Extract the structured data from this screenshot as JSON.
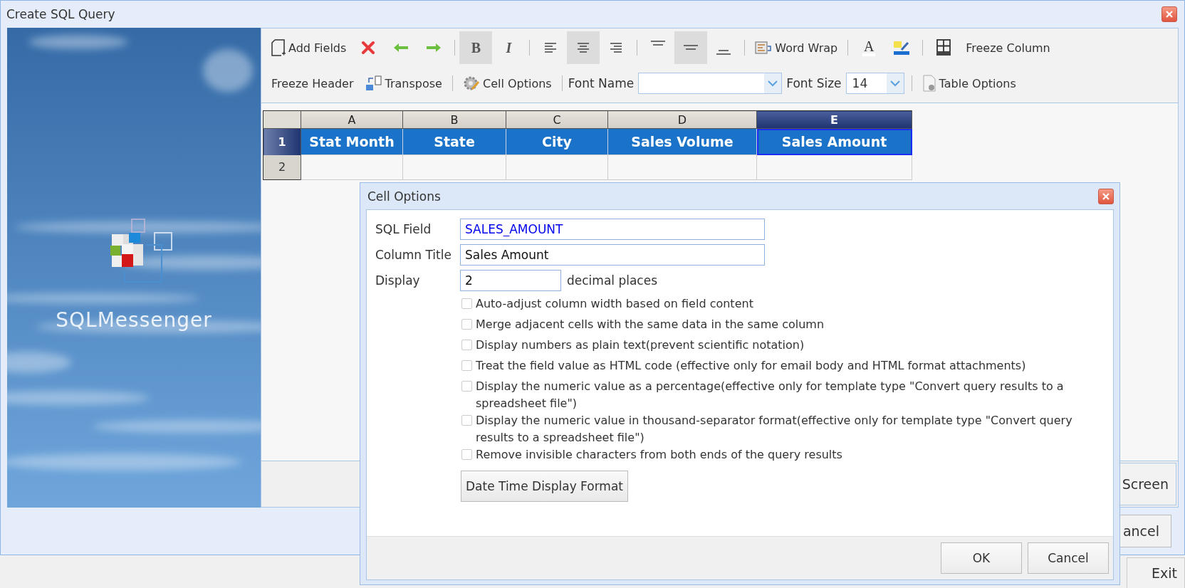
{
  "window": {
    "title": "Create SQL Query"
  },
  "brand": {
    "name": "SQLMessenger"
  },
  "toolbar": {
    "rows": [
      [
        {
          "kind": "add",
          "label": "Add Fields"
        },
        {
          "kind": "delete"
        },
        {
          "kind": "move-left"
        },
        {
          "kind": "move-right"
        },
        {
          "kind": "separator"
        },
        {
          "kind": "bold",
          "glyph": "B",
          "selected": true
        },
        {
          "kind": "italic",
          "glyph": "I",
          "selected": false
        },
        {
          "kind": "separator"
        },
        {
          "kind": "align-left",
          "selected": false
        },
        {
          "kind": "align-center",
          "selected": true
        },
        {
          "kind": "align-right",
          "selected": false
        },
        {
          "kind": "separator"
        },
        {
          "kind": "valign-top",
          "selected": false
        },
        {
          "kind": "valign-middle",
          "selected": true
        },
        {
          "kind": "valign-bottom",
          "selected": false
        },
        {
          "kind": "separator"
        },
        {
          "kind": "word-wrap",
          "label": "Word Wrap"
        },
        {
          "kind": "separator"
        },
        {
          "kind": "font-color",
          "glyph": "A"
        },
        {
          "kind": "highlight"
        },
        {
          "kind": "separator"
        },
        {
          "kind": "freeze-grid"
        },
        {
          "kind": "text",
          "label": "Freeze Column"
        }
      ],
      [
        {
          "kind": "text",
          "label": "Freeze Header"
        },
        {
          "kind": "transpose",
          "label": "Transpose"
        },
        {
          "kind": "separator"
        },
        {
          "kind": "cell-options",
          "label": "Cell Options"
        },
        {
          "kind": "separator"
        },
        {
          "kind": "field-label",
          "label": "Font Name"
        },
        {
          "kind": "font-name-select"
        },
        {
          "kind": "field-label",
          "label": "Font Size"
        },
        {
          "kind": "font-size-select",
          "value": "14"
        },
        {
          "kind": "separator"
        },
        {
          "kind": "table-options",
          "label": "Table Options"
        }
      ]
    ]
  },
  "table": {
    "columns": [
      {
        "letter": "A",
        "selected": false
      },
      {
        "letter": "B",
        "selected": false
      },
      {
        "letter": "C",
        "selected": false
      },
      {
        "letter": "D",
        "selected": false
      },
      {
        "letter": "E",
        "selected": true
      }
    ],
    "rows": [
      {
        "number": "1",
        "selected": true,
        "cells": [
          "Stat Month",
          "State",
          "City",
          "Sales Volume",
          "Sales Amount"
        ]
      },
      {
        "number": "2",
        "selected": false
      }
    ]
  },
  "pane_footer": {
    "button": "Screen"
  },
  "window_footer": {
    "button": "ancel"
  },
  "taskbar": {
    "button": "Exit"
  },
  "dialog": {
    "title": "Cell Options",
    "sql_field": {
      "label": "SQL Field",
      "value": "SALES_AMOUNT"
    },
    "column_title": {
      "label": "Column Title",
      "value": "Sales Amount"
    },
    "display": {
      "label": "Display",
      "value": "2",
      "suffix": "decimal places"
    },
    "options": [
      {
        "label": "Auto-adjust column width based on field content",
        "checked": false
      },
      {
        "label": "Merge adjacent cells with the same data in the same column",
        "checked": false
      },
      {
        "label": "Display numbers as plain text(prevent scientific notation)",
        "checked": false
      },
      {
        "label": "Treat the field value as HTML code (effective only for email body and HTML format attachments)",
        "checked": false
      },
      {
        "label": "Display the numeric value as a percentage(effective only for template type \"Convert query results to a spreadsheet file\")",
        "checked": false
      },
      {
        "label": "Display the numeric value in thousand-separator format(effective only for template type \"Convert query results to a spreadsheet file\")",
        "checked": false
      },
      {
        "label": "Remove invisible characters from both ends of the query results",
        "checked": false
      }
    ],
    "format_button": "Date Time Display Format",
    "buttons": [
      "OK",
      "Cancel"
    ]
  }
}
